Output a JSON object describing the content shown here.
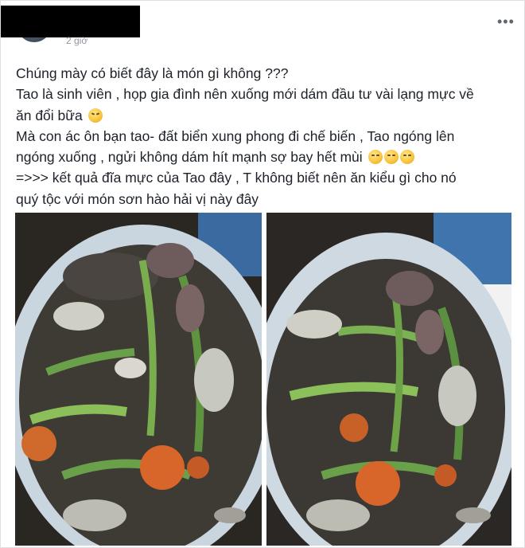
{
  "post": {
    "author_name": "",
    "timestamp": "2 giờ",
    "more_icon": "three-dots-icon",
    "text_lines": [
      "Chúng mày có biết đây là món gì không ???",
      "Tao là sinh viên , họp gia đình nên xuống mới dám đầu tư vài lạng mực về",
      "ăn đổi bữa",
      "Mà con ác ôn bạn tao- đất biển xung phong đi chế biến , Tao ngóng lên",
      "ngóng xuống , ngửi không dám hít mạnh sợ bay hết mùi",
      "=>>> kết quả đĩa mực của Tao đây , T không biết nên ăn kiểu gì cho nó",
      "quý tộc với món sơn hào hải vị này đây"
    ],
    "emojis": {
      "line3": "tired-face-emoji",
      "line5": [
        "pensive-face-emoji",
        "pensive-face-emoji",
        "pensive-face-emoji"
      ]
    },
    "photos": [
      "squid-dish-photo-1",
      "squid-dish-photo-2"
    ]
  }
}
